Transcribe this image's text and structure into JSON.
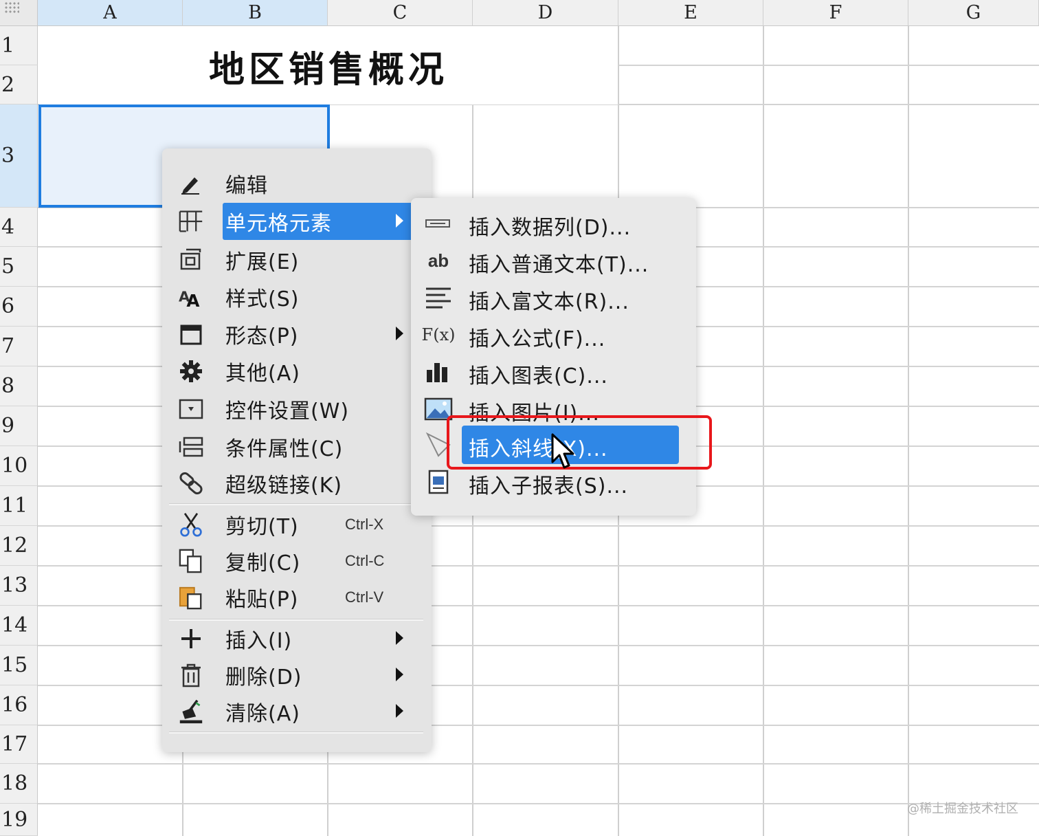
{
  "sheet": {
    "columns": [
      "A",
      "B",
      "C",
      "D",
      "E",
      "F",
      "G"
    ],
    "rows": [
      "1",
      "2",
      "3",
      "4",
      "5",
      "6",
      "7",
      "8",
      "9",
      "10",
      "11",
      "12",
      "13",
      "14",
      "15",
      "16",
      "17",
      "18",
      "19"
    ],
    "title_cell": "地区销售概况"
  },
  "context_menu": {
    "items": [
      {
        "icon": "pencil-icon",
        "label": "编辑"
      },
      {
        "icon": "cell-element-icon",
        "label": "单元格元素"
      },
      {
        "icon": "expand-icon",
        "label": "扩展(E)"
      },
      {
        "icon": "style-icon",
        "label": "样式(S)"
      },
      {
        "icon": "form-icon",
        "label": "形态(P)"
      },
      {
        "icon": "gear-icon",
        "label": "其他(A)"
      },
      {
        "icon": "widget-icon",
        "label": "控件设置(W)"
      },
      {
        "icon": "condition-icon",
        "label": "条件属性(C)"
      },
      {
        "icon": "link-icon",
        "label": "超级链接(K)"
      },
      {
        "icon": "scissors-icon",
        "label": "剪切(T)",
        "shortcut": "Ctrl-X"
      },
      {
        "icon": "copy-icon",
        "label": "复制(C)",
        "shortcut": "Ctrl-C"
      },
      {
        "icon": "paste-icon",
        "label": "粘贴(P)",
        "shortcut": "Ctrl-V"
      },
      {
        "icon": "plus-icon",
        "label": "插入(I)"
      },
      {
        "icon": "trash-icon",
        "label": "删除(D)"
      },
      {
        "icon": "broom-icon",
        "label": "清除(A)"
      }
    ]
  },
  "submenu": {
    "items": [
      {
        "icon": "data-column-icon",
        "label": "插入数据列(D)..."
      },
      {
        "icon": "plain-text-icon",
        "icon_text": "ab",
        "label": "插入普通文本(T)..."
      },
      {
        "icon": "rich-text-icon",
        "label": "插入富文本(R)..."
      },
      {
        "icon": "formula-icon",
        "icon_text": "F(x)",
        "label": "插入公式(F)..."
      },
      {
        "icon": "chart-icon",
        "label": "插入图表(C)..."
      },
      {
        "icon": "image-icon",
        "label": "插入图片(I)..."
      },
      {
        "icon": "slash-line-icon",
        "label": "插入斜线(X)..."
      },
      {
        "icon": "sub-report-icon",
        "label": "插入子报表(S)..."
      }
    ]
  },
  "watermark": "@稀土掘金技术社区",
  "colors": {
    "highlight": "#2f87e6",
    "selection_border": "#1f7de0",
    "callout": "#e8171b"
  }
}
